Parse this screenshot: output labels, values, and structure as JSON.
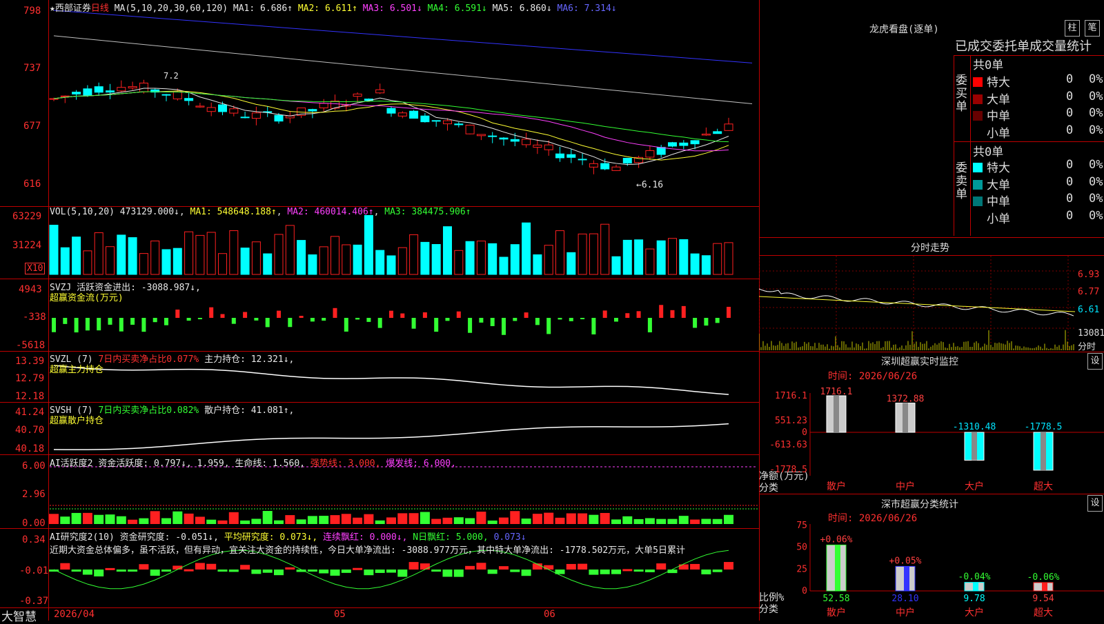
{
  "main_header": {
    "star": "★",
    "stock": "西部证券",
    "period": "日线",
    "ma_params": "MA(5,10,20,30,60,120)",
    "ma1": "MA1: 6.686↑",
    "ma2": "MA2: 6.611↑",
    "ma3": "MA3: 6.501↓",
    "ma4": "MA4: 6.591↓",
    "ma5": "MA5: 6.860↓",
    "ma6": "MA6: 7.314↓"
  },
  "price_axis": [
    "798",
    "737",
    "677",
    "616"
  ],
  "price_annotations": {
    "high": "7.2",
    "low": "←6.16"
  },
  "vol_header": {
    "name": "VOL(5,10,20)",
    "vol": "473129.000↓",
    "ma1": "MA1: 548648.188↑",
    "ma2": "MA2: 460014.406↑",
    "ma3": "MA3: 384475.906↑"
  },
  "vol_axis": [
    "63229",
    "31224"
  ],
  "vol_unit": "X10",
  "svzj_header": {
    "name": "SVZJ",
    "text": "活跃资金进出: -3088.987↓,",
    "sub": "超赢资金流(万元)"
  },
  "svzj_axis": [
    "4943",
    "-338",
    "-5618"
  ],
  "svzl_header": {
    "name": "SVZL (7)",
    "pct": "7日内买卖净占比0.077%",
    "hold": "主力持仓: 12.321↓,",
    "sub": "超赢主力持仓"
  },
  "svzl_axis": [
    "13.39",
    "12.79",
    "12.18"
  ],
  "svsh_header": {
    "name": "SVSH (7)",
    "pct": "7日内买卖净占比0.082%",
    "hold": "散户持仓: 41.081↑,",
    "sub": "超赢散户持仓"
  },
  "svsh_axis": [
    "41.24",
    "40.70",
    "40.18"
  ],
  "ai1_header": {
    "name": "AI活跃度2",
    "a": "资金活跃度: 0.797↓, 1.959,",
    "b": "生命线: 1.560,",
    "c": "强势线: 3.000,",
    "d": "爆发线: 6.000,"
  },
  "ai1_axis": [
    "6.00",
    "2.96",
    "0.00"
  ],
  "ai2_header": {
    "name": "AI研究度2(10)",
    "a": "资金研究度: -0.051↓,",
    "b": "平均研究度: 0.073↓,",
    "c": "连续飘红: 0.000↓,",
    "d": "N日飘红: 5.000,",
    "e": "0.073↓"
  },
  "ai2_text": "近期大资金总体偏多，虽不活跃，但有异动，宜关注大资金的持续性，今日大单净流出: -3088.977万元，其中特大单净流出: -1778.502万元，大单5日累计",
  "ai2_axis": [
    "0.34",
    "-0.01",
    "-0.37"
  ],
  "bottom": {
    "brand": "大智慧",
    "date1": "2026/04",
    "date2": "05",
    "date3": "06"
  },
  "dragon": {
    "title": "龙虎看盘(逐单)",
    "btn1": "柱",
    "btn2": "笔",
    "subtitle": "已成交委托单成交量统计",
    "buy_side": "委买单",
    "sell_side": "委卖单",
    "buy_total": "共0单",
    "sell_total": "共0单",
    "buy_rows": [
      {
        "label": "特大",
        "n": "0",
        "p": "0%",
        "color": "#ff0000"
      },
      {
        "label": "大单",
        "n": "0",
        "p": "0%",
        "color": "#990000"
      },
      {
        "label": "中单",
        "n": "0",
        "p": "0%",
        "color": "#660000"
      },
      {
        "label": "小单",
        "n": "0",
        "p": "0%",
        "color": ""
      }
    ],
    "sell_rows": [
      {
        "label": "特大",
        "n": "0",
        "p": "0%",
        "color": "#00ffff"
      },
      {
        "label": "大单",
        "n": "0",
        "p": "0%",
        "color": "#009999"
      },
      {
        "label": "中单",
        "n": "0",
        "p": "0%",
        "color": "#007777"
      },
      {
        "label": "小单",
        "n": "0",
        "p": "0%",
        "color": ""
      }
    ]
  },
  "intraday": {
    "title": "分时走势",
    "axis": [
      "6.93",
      "6.77",
      "6.61"
    ],
    "vol": "13081",
    "vol_unit": "分时"
  },
  "monitor": {
    "title": "深圳超赢实时监控",
    "btn": "设",
    "time": "时间: 2026/06/26",
    "axis": [
      "1716.1",
      "551.23",
      "0",
      "-613.63",
      "-1778.5"
    ],
    "ylabel": "净额(万元)",
    "xlabel": "分类",
    "categories": [
      "散户",
      "中户",
      "大户",
      "超大"
    ],
    "values": [
      1716.1,
      1372.88,
      -1310.48,
      -1778.5
    ],
    "labels": [
      "1716.1",
      "1372.88",
      "-1310.48",
      "-1778.5"
    ]
  },
  "classify": {
    "title": "深市超赢分类统计",
    "btn": "设",
    "time": "时间: 2026/06/26",
    "axis": [
      "75",
      "50",
      "25",
      "0"
    ],
    "ylabel": "比例%",
    "xlabel": "分类",
    "categories": [
      "散户",
      "中户",
      "大户",
      "超大"
    ],
    "values": [
      52.58,
      28.1,
      9.78,
      9.54
    ],
    "values_text": [
      "52.58",
      "28.10",
      "9.78",
      "9.54"
    ],
    "changes": [
      "+0.06%",
      "+0.05%",
      "-0.04%",
      "-0.06%"
    ]
  },
  "chart_data": {
    "type": "bar",
    "title": "深圳超赢实时监控",
    "categories": [
      "散户",
      "中户",
      "大户",
      "超大"
    ],
    "series": [
      {
        "name": "净额(万元)",
        "values": [
          1716.1,
          1372.88,
          -1310.48,
          -1778.5
        ]
      },
      {
        "name": "比例%",
        "values": [
          52.58,
          28.1,
          9.78,
          9.54
        ]
      }
    ]
  }
}
